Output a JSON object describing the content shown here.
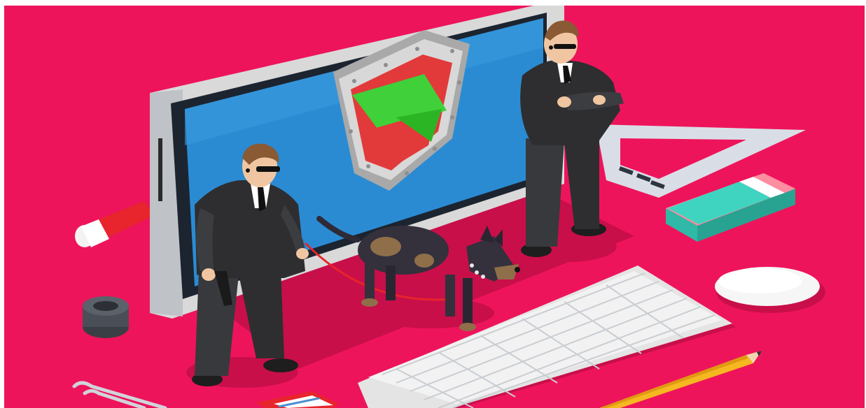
{
  "scene": {
    "description_icons": [
      "computer-monitor-icon",
      "security-shield-icon",
      "guard-dog-icon",
      "keyboard-icon",
      "mouse-icon",
      "pencil-icon",
      "eraser-icon",
      "ruler-icon",
      "paperclip-icon",
      "tape-roll-icon",
      "marker-icon"
    ],
    "colors": {
      "background": "#EE145B",
      "shadow": "#C80F4A",
      "screen": "#2A8BD3",
      "shield_red": "#E23A3A",
      "shield_green": "#3FD03A",
      "suit": "#2E2E30",
      "hair": "#8A5A34",
      "keyboard": "#F2F2F2"
    }
  }
}
